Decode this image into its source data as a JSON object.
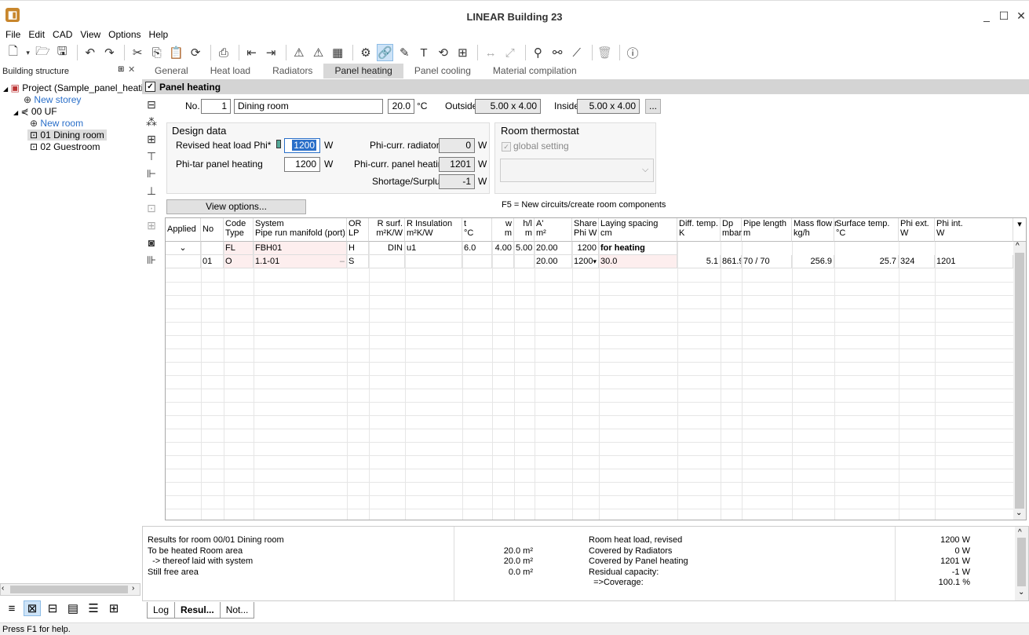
{
  "app": {
    "title": "LINEAR Building 23",
    "logo": "◧",
    "minimize": "_",
    "maximize": "☐",
    "close": "✕"
  },
  "menu": [
    "File",
    "Edit",
    "CAD",
    "View",
    "Options",
    "Help"
  ],
  "building_structure": {
    "title": "Building structure",
    "pin": "⊞",
    "close": "✕",
    "tree": [
      {
        "label": "Project (Sample_panel_heatin",
        "expander": "◢",
        "icon": "project-icon"
      },
      {
        "label": "New storey",
        "expander": "",
        "icon": "add-icon"
      },
      {
        "label": "00 UF",
        "expander": "◢",
        "icon": "storey-icon"
      },
      {
        "label": "New room",
        "expander": "",
        "icon": "add-icon"
      },
      {
        "label": "01 Dining room",
        "expander": "",
        "icon": "room-icon"
      },
      {
        "label": "02 Guestroom",
        "expander": "",
        "icon": "room-icon"
      }
    ]
  },
  "tabs": [
    "General",
    "Heat load",
    "Radiators",
    "Panel heating",
    "Panel cooling",
    "Material compilation"
  ],
  "panel": {
    "title": "Panel heating",
    "check": "✓"
  },
  "room": {
    "no_label": "No.",
    "no": "1",
    "name": "Dining room",
    "temp": "20.0",
    "temp_unit": "°C",
    "outside_label": "Outside",
    "outside": "5.00 x 4.00",
    "inside_label": "Inside",
    "inside": "5.00 x 4.00",
    "more": "..."
  },
  "design": {
    "title": "Design data",
    "revised_label": "Revised heat load Phi*",
    "revised": "1200",
    "revised_unit": "W",
    "phitar_label": "Phi-tar panel heating",
    "phitar": "1200",
    "phitar_unit": "W",
    "phirad_label": "Phi-curr. radiators",
    "phirad": "0",
    "phirad_unit": "W",
    "phipanel_label": "Phi-curr. panel heating",
    "phipanel": "1201",
    "phipanel_unit": "W",
    "short_label": "Shortage/Surplus",
    "short": "-1",
    "short_unit": "W"
  },
  "thermostat": {
    "title": "Room thermostat",
    "global": "global setting",
    "check": "✓",
    "dropdown": "⌵"
  },
  "view_options": "View options...",
  "hint": "F5 = New circuits/create room components",
  "grid": {
    "headers": [
      "Applied",
      "No",
      "Code\nType",
      "System\nPipe run manifold (port)",
      "OR\nLP",
      "R surf.\nm²K/W",
      "R Insulation\nm²K/W",
      "t\n°C",
      "w\nm",
      "h/l\nm",
      "A'\nm²",
      "Share\nPhi W",
      "Laying spacing\ncm",
      "Diff. temp.\nK",
      "Dp\nmbar",
      "Pipe length\nm",
      "Mass flow r\nkg/h",
      "Surface temp.\n°C",
      "Phi ext.\nW",
      "Phi int.\nW"
    ],
    "row1": {
      "applied": "⌄",
      "code": "FL",
      "system": "FBH01",
      "or": "H",
      "rsurf": "DIN",
      "rins": "u1",
      "t": "6.0",
      "w": "4.00",
      "h": "5.00",
      "a": "20.00",
      "share": "1200",
      "laying": "for heating"
    },
    "row2": {
      "no": "01",
      "code": "O",
      "system": "1.1-01",
      "sys_sep": "–",
      "or": "S",
      "a": "20.00",
      "share": "1200",
      "share_arrow": "▾",
      "laying": "30.0",
      "diff": "5.1",
      "dp": "861.9",
      "pipe": "70 / 70",
      "mass": "256.9",
      "surface": "25.7",
      "phiext": "324",
      "phiint": "1201"
    },
    "menu_glyph": "▾",
    "scroll_up": "^",
    "scroll_down": "⌄"
  },
  "results": {
    "left": [
      "Results for room 00/01 Dining room",
      "To be heated Room area",
      "  -> thereof laid with system",
      "Still free area"
    ],
    "mid": [
      "",
      "20.0 m²",
      "20.0 m²",
      "0.0 m²"
    ],
    "right": [
      "Room heat load, revised",
      "Covered by Radiators",
      "Covered by Panel heating",
      "Residual capacity:",
      "  =>Coverage:"
    ],
    "vals": [
      "1200 W",
      "0 W",
      "1201 W",
      "-1 W",
      "100.1 %"
    ],
    "scroll_up": "^",
    "scroll_down": "⌄"
  },
  "bottom_tabs": [
    "Log",
    "Resul...",
    "Not..."
  ],
  "status": "Press F1 for help."
}
